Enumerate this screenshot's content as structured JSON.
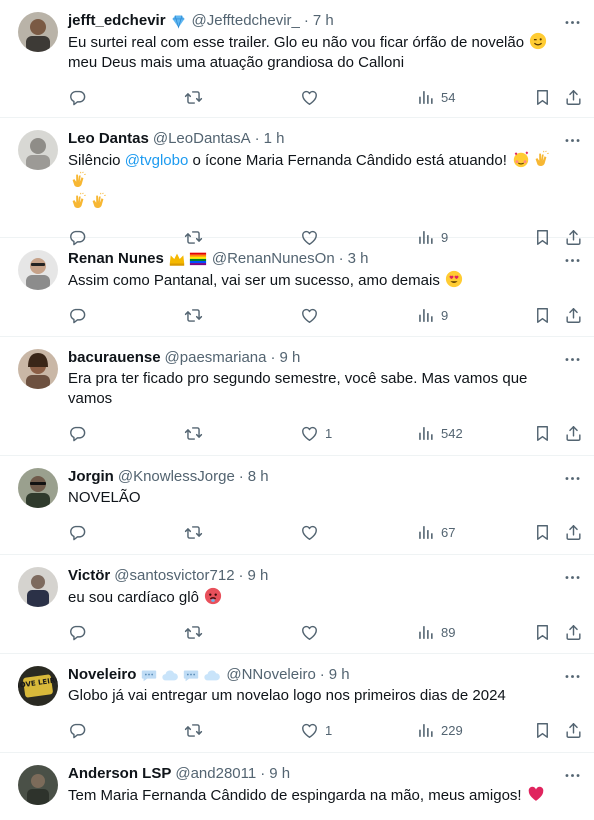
{
  "tweets": [
    {
      "name": "jefft_edchevir",
      "handle": "@Jefftedchevir_",
      "dot": "·",
      "time": "7 h",
      "text": "Eu surtei real com esse trailer. Glo eu não vou ficar órfão de novelão",
      "text2": "meu Deus mais uma atuação grandiosa do Calloni",
      "likes": "",
      "views": "54"
    },
    {
      "name": "Leo Dantas",
      "handle": "@LeoDantasA",
      "dot": "·",
      "time": "1 h",
      "text_pre": "Silêncio ",
      "mention": "@tvglobo",
      "text_post": " o ícone Maria Fernanda Cândido está atuando!",
      "likes": "",
      "views": "9"
    },
    {
      "name": "Renan Nunes",
      "handle": "@RenanNunesOn",
      "dot": "·",
      "time": "3 h",
      "text": "Assim como Pantanal, vai ser um sucesso, amo demais",
      "likes": "",
      "views": "9"
    },
    {
      "name": "bacurauense",
      "handle": "@paesmariana",
      "dot": "·",
      "time": "9 h",
      "text": "Era pra ter ficado pro segundo semestre, você sabe. Mas vamos que",
      "text2": "vamos",
      "likes": "1",
      "views": "542"
    },
    {
      "name": "Jorgin",
      "handle": "@KnowlessJorge",
      "dot": "·",
      "time": "8 h",
      "text": "NOVELÃO",
      "likes": "",
      "views": "67"
    },
    {
      "name": "Victör",
      "handle": "@santosvictor712",
      "dot": "·",
      "time": "9 h",
      "text": "eu sou cardíaco glô",
      "likes": "",
      "views": "89"
    },
    {
      "name": "Noveleiro",
      "handle": "@NNoveleiro",
      "dot": "·",
      "time": "9 h",
      "text": "Globo já vai entregar um novelao logo nos primeiros dias de 2024",
      "likes": "1",
      "views": "229",
      "avatar_text": "NOVE LEIRO"
    },
    {
      "name": "Anderson LSP",
      "handle": "@and28011",
      "dot": "·",
      "time": "9 h",
      "text": "Tem Maria Fernanda Cândido de espingarda na mão, meus amigos!",
      "likes": "",
      "views": ""
    }
  ],
  "colors": {
    "text": "#0f1419",
    "secondary": "#536471",
    "link": "#1d9bf0",
    "divider": "#eff3f4",
    "verified_badge": "#1d9bf0"
  },
  "icons": [
    "reply-icon",
    "retweet-icon",
    "like-icon",
    "views-icon",
    "bookmark-icon",
    "share-icon",
    "more-icon"
  ]
}
